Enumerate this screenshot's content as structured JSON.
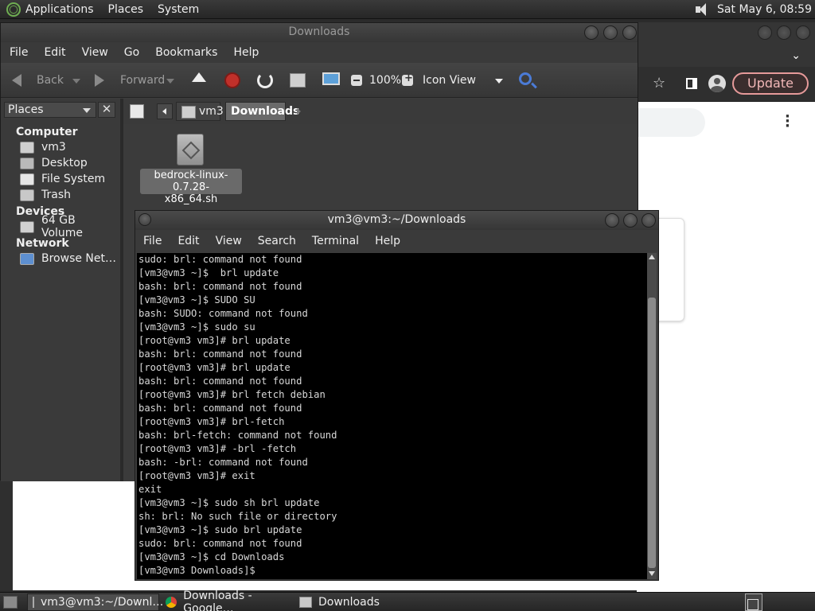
{
  "top_panel": {
    "menus": [
      "Applications",
      "Places",
      "System"
    ],
    "clock": "Sat May  6, 08:59"
  },
  "browser": {
    "update_label": "Update"
  },
  "file_manager": {
    "title": "Downloads",
    "menus": [
      "File",
      "Edit",
      "View",
      "Go",
      "Bookmarks",
      "Help"
    ],
    "toolbar": {
      "back_label": "Back",
      "forward_label": "Forward",
      "zoom_level": "100%",
      "view_mode": "Icon View"
    },
    "sidebar": {
      "header": "Places",
      "sections": [
        {
          "title": "Computer",
          "items": [
            "vm3",
            "Desktop",
            "File System",
            "Trash"
          ]
        },
        {
          "title": "Devices",
          "items": [
            "64 GB Volume"
          ]
        },
        {
          "title": "Network",
          "items": [
            "Browse Net…"
          ]
        }
      ]
    },
    "path": {
      "home": "vm3",
      "current": "Downloads"
    },
    "files": [
      {
        "name_line1": "bedrock-linux-0.7.28-",
        "name_line2": "x86_64.sh"
      }
    ]
  },
  "terminal": {
    "title": "vm3@vm3:~/Downloads",
    "menus": [
      "File",
      "Edit",
      "View",
      "Search",
      "Terminal",
      "Help"
    ],
    "lines": [
      "sudo: brl: command not found",
      "[vm3@vm3 ~]$  brl update",
      "bash: brl: command not found",
      "[vm3@vm3 ~]$ SUDO SU",
      "bash: SUDO: command not found",
      "[vm3@vm3 ~]$ sudo su",
      "[root@vm3 vm3]# brl update",
      "bash: brl: command not found",
      "[root@vm3 vm3]# brl update",
      "bash: brl: command not found",
      "[root@vm3 vm3]# brl fetch debian",
      "bash: brl: command not found",
      "[root@vm3 vm3]# brl-fetch",
      "bash: brl-fetch: command not found",
      "[root@vm3 vm3]# -brl -fetch",
      "bash: -brl: command not found",
      "[root@vm3 vm3]# exit",
      "exit",
      "[vm3@vm3 ~]$ sudo sh brl update",
      "sh: brl: No such file or directory",
      "[vm3@vm3 ~]$ sudo brl update",
      "sudo: brl: command not found",
      "[vm3@vm3 ~]$ cd Downloads",
      "[vm3@vm3 Downloads]$ "
    ]
  },
  "taskbar": {
    "tasks": [
      {
        "label": "vm3@vm3:~/Downl…",
        "icon": "terminal-icon"
      },
      {
        "label": "Downloads - Google…",
        "icon": "chrome-icon"
      },
      {
        "label": "Downloads",
        "icon": "folder-icon"
      }
    ]
  }
}
